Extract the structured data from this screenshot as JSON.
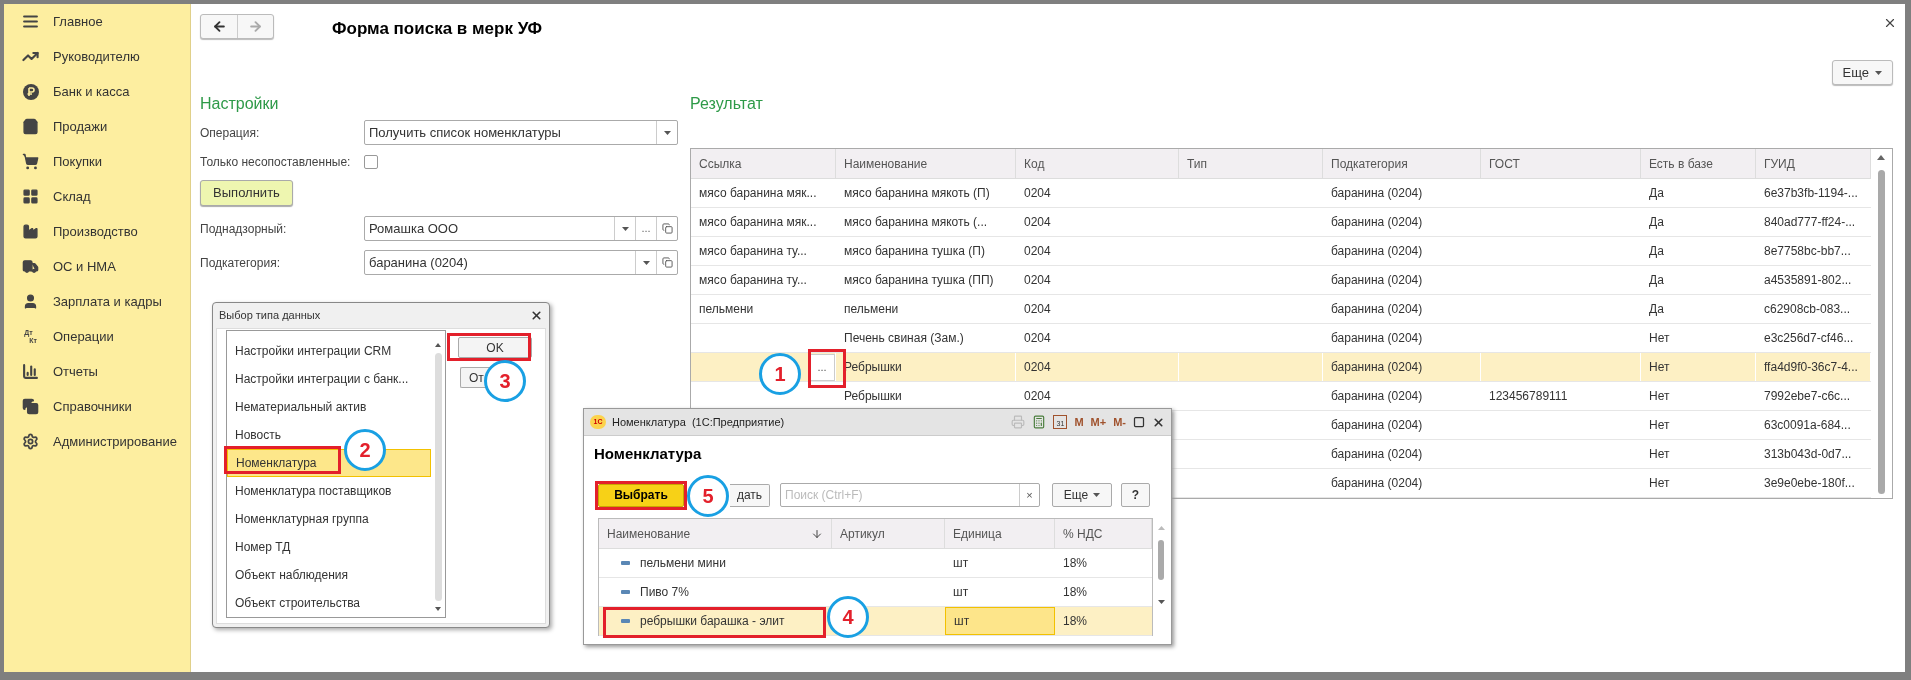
{
  "sidebar": {
    "items": [
      {
        "label": "Главное"
      },
      {
        "label": "Руководителю"
      },
      {
        "label": "Банк и касса"
      },
      {
        "label": "Продажи"
      },
      {
        "label": "Покупки"
      },
      {
        "label": "Склад"
      },
      {
        "label": "Производство"
      },
      {
        "label": "ОС и НМА"
      },
      {
        "label": "Зарплата и кадры"
      },
      {
        "label": "Операции",
        "icon_text": [
          "Дт",
          "Кт"
        ]
      },
      {
        "label": "Отчеты"
      },
      {
        "label": "Справочники"
      },
      {
        "label": "Администрирование"
      }
    ]
  },
  "page": {
    "title": "Форма поиска в мерк УФ",
    "back_disabled": false,
    "forward_disabled": true,
    "more_button": "Еще"
  },
  "settings": {
    "heading": "Настройки",
    "operation": {
      "label": "Операция:",
      "value": "Получить список номенклатуры"
    },
    "unmatched_only": {
      "label": "Только несопоставленные:",
      "checked": false
    },
    "run_button": "Выполнить",
    "supervised": {
      "label": "Поднадзорный:",
      "value": "Ромашка ООО",
      "choose_button": "..."
    },
    "subcategory": {
      "label": "Подкатегория:",
      "value": "баранина (0204)"
    }
  },
  "result": {
    "heading": "Результат",
    "table": {
      "columns": [
        "Ссылка",
        "Наименование",
        "Код",
        "Тип",
        "Подкатегория",
        "ГОСТ",
        "Есть в базе",
        "ГУИД"
      ],
      "rows": [
        {
          "selected": false,
          "cells": [
            "мясо баранина мяк...",
            "мясо баранина мякоть (П)",
            "0204",
            null,
            "баранина (0204)",
            null,
            "Да",
            "6e37b3fb-1194-..."
          ]
        },
        {
          "selected": false,
          "cells": [
            "мясо баранина мяк...",
            "мясо баранина мякоть (...",
            "0204",
            null,
            "баранина (0204)",
            null,
            "Да",
            "840ad777-ff24-..."
          ]
        },
        {
          "selected": false,
          "cells": [
            "мясо баранина ту...",
            "мясо баранина тушка (П)",
            "0204",
            null,
            "баранина (0204)",
            null,
            "Да",
            "8e7758bc-bb7..."
          ]
        },
        {
          "selected": false,
          "cells": [
            "мясо баранина ту...",
            "мясо баранина тушка (ПП)",
            "0204",
            null,
            "баранина (0204)",
            null,
            "Да",
            "a4535891-802..."
          ]
        },
        {
          "selected": false,
          "cells": [
            "пельмени",
            "пельмени",
            "0204",
            null,
            "баранина (0204)",
            null,
            "Да",
            "c62908cb-083..."
          ]
        },
        {
          "selected": false,
          "cells": [
            null,
            "Печень свиная (Зам.)",
            "0204",
            null,
            "баранина (0204)",
            null,
            "Нет",
            "e3c256d7-cf46..."
          ]
        },
        {
          "selected": true,
          "edit_button": "...",
          "cells": [
            null,
            "Ребрышки",
            "0204",
            null,
            "баранина (0204)",
            null,
            "Нет",
            "ffa4d9f0-36c7-4..."
          ]
        },
        {
          "selected": false,
          "cells": [
            null,
            "Ребрышки",
            "0204",
            null,
            "баранина (0204)",
            "123456789111",
            "Нет",
            "7992ebe7-c6c..."
          ]
        },
        {
          "selected": false,
          "cells": [
            null,
            null,
            null,
            null,
            "баранина (0204)",
            null,
            "Нет",
            "63c0091a-684..."
          ]
        },
        {
          "selected": false,
          "cells": [
            null,
            null,
            null,
            null,
            "баранина (0204)",
            null,
            "Нет",
            "313b043d-0d7..."
          ]
        },
        {
          "selected": false,
          "cells": [
            null,
            null,
            null,
            null,
            "баранина (0204)",
            null,
            "Нет",
            "3e9e0ebe-180f..."
          ]
        }
      ]
    }
  },
  "type_dialog": {
    "title": "Выбор типа данных",
    "ok_button": "OK",
    "cancel_button": "От",
    "items": [
      {
        "label": "Настройки интеграции CRM",
        "selected": false
      },
      {
        "label": "Настройки интеграции с банк...",
        "selected": false
      },
      {
        "label": "Нематериальный актив",
        "selected": false
      },
      {
        "label": "Новость",
        "selected": false
      },
      {
        "label": "Номенклатура",
        "selected": true
      },
      {
        "label": "Номенклатура поставщиков",
        "selected": false
      },
      {
        "label": "Номенклатурная группа",
        "selected": false
      },
      {
        "label": "Номер ТД",
        "selected": false
      },
      {
        "label": "Объект наблюдения",
        "selected": false
      },
      {
        "label": "Объект строительства",
        "selected": false
      }
    ]
  },
  "catalog_dialog": {
    "logo": "1С",
    "title": "Номенклатура  (1С:Предприятие)",
    "calendar_day": "31",
    "memory_buttons": [
      "M",
      "M+",
      "M-"
    ],
    "heading": "Номенклатура",
    "select_button": "Выбрать",
    "create_button": "дать",
    "search": {
      "placeholder": "Поиск (Ctrl+F)",
      "clear": "×"
    },
    "more_button": "Еще",
    "help_button": "?",
    "table": {
      "columns": [
        {
          "label": "Наименование",
          "sorted": true
        },
        {
          "label": "Артикул",
          "sorted": false
        },
        {
          "label": "Единица",
          "sorted": false
        },
        {
          "label": "% НДС",
          "sorted": false
        }
      ],
      "rows": [
        {
          "selected": false,
          "focused": [
            false,
            false,
            false,
            false
          ],
          "cells": [
            "пельмени мини",
            null,
            "шт",
            "18%"
          ]
        },
        {
          "selected": false,
          "focused": [
            false,
            false,
            false,
            false
          ],
          "cells": [
            "Пиво 7%",
            null,
            "шт",
            "18%"
          ]
        },
        {
          "selected": true,
          "focused": [
            false,
            false,
            true,
            false
          ],
          "cells": [
            "ребрышки барашка - элит",
            null,
            "шт",
            "18%"
          ]
        }
      ]
    }
  },
  "annotations": [
    {
      "label": "1"
    },
    {
      "label": "2"
    },
    {
      "label": "3"
    },
    {
      "label": "4"
    },
    {
      "label": "5"
    }
  ]
}
